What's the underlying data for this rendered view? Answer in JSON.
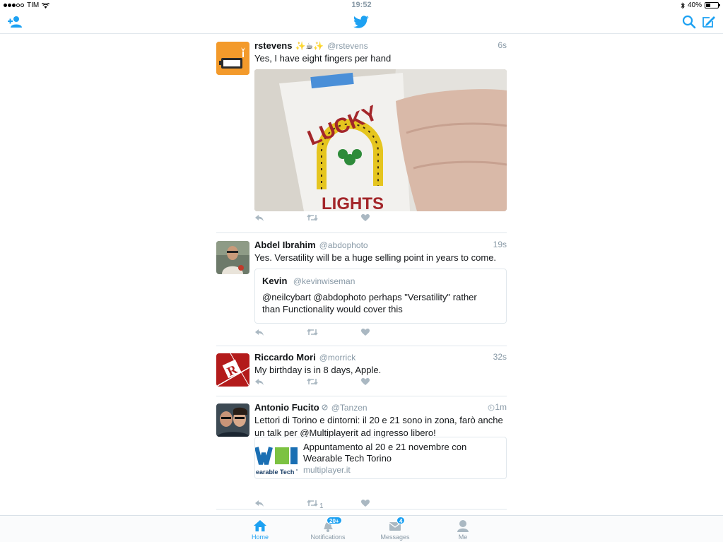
{
  "status_bar": {
    "carrier": "TIM",
    "time": "19:52",
    "battery": "40%",
    "battery_level": 0.4
  },
  "nav": {
    "logo": "twitter-bird-icon",
    "left_icon": "add-user-icon",
    "right_icons": [
      "search-icon",
      "compose-icon"
    ]
  },
  "tweets": [
    {
      "name": "rstevens",
      "emoji": "✨☕✨",
      "handle": "@rstevens",
      "time": "6s",
      "text": "Yes, I have eight fingers per hand"
    },
    {
      "name": "Abdel Ibrahim",
      "handle": "@abdophoto",
      "time": "19s",
      "text": "Yes. Versatility will be a huge selling point in years to come.",
      "quote": {
        "name": "Kevin",
        "handle": "@kevinwiseman",
        "text": "@neilcybart @abdophoto perhaps \"Versatility\" rather than Functionality would cover this"
      }
    },
    {
      "name": "Riccardo Mori",
      "handle": "@morrick",
      "time": "32s",
      "text": "My birthday is in 8 days, Apple."
    },
    {
      "name": "Antonio Fucito",
      "handle": "@Tanzen",
      "time": "1m",
      "text": "Lettori di Torino e dintorni: il 20 e 21 sono in zona, farò anche un talk per @Multiplayerit ad ingresso libero!",
      "retweets": "1",
      "card": {
        "title": "Appuntamento al 20 e 21 novembre con Wearable Tech Torino",
        "domain": "multiplayer.it",
        "thumb_text": "earable Tech To"
      }
    }
  ],
  "photo": {
    "box_text_1": "LUCKY",
    "box_text_2": "LIGHTS"
  },
  "tabs": [
    {
      "label": "Home",
      "active": true
    },
    {
      "label": "Notifications",
      "badge": "20+"
    },
    {
      "label": "Messages",
      "badge": "4"
    },
    {
      "label": "Me"
    }
  ],
  "colors": {
    "accent": "#1da1f2",
    "secondary_text": "#8899a6",
    "border": "#e1e8ed"
  }
}
